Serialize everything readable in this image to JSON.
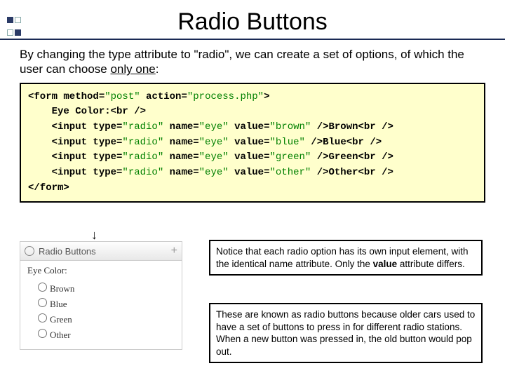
{
  "title": "Radio Buttons",
  "intro": {
    "part1": "By changing the type attribute to \"radio\", we can create a set of options, of which the user can choose ",
    "underline": "only one",
    "part2": ":"
  },
  "code": {
    "l1a": "<form method=",
    "l1b": "\"post\"",
    "l1c": " action=",
    "l1d": "\"process.php\"",
    "l1e": ">",
    "l2": "    Eye Color:<br />",
    "l3a": "    <input type=",
    "l3b": "\"radio\"",
    "l3c": " name=",
    "l3d": "\"eye\"",
    "l3e": " value=",
    "l3f": "\"brown\"",
    "l3g": " />Brown<br />",
    "l4f": "\"blue\"",
    "l4g": " />Blue<br />",
    "l5f": "\"green\"",
    "l5g": " />Green<br />",
    "l6f": "\"other\"",
    "l6g": " />Other<br />",
    "l7": "</form>"
  },
  "demo": {
    "header": "Radio Buttons",
    "label": "Eye Color:",
    "options": [
      "Brown",
      "Blue",
      "Green",
      "Other"
    ]
  },
  "note1": {
    "p1": "Notice that each radio option has its own input element, with the identical name attribute.  Only the ",
    "b": "value",
    "p2": " attribute differs."
  },
  "note2": "These are known as radio buttons because older cars used to have a set of buttons to press in for different radio stations.  When a new button was pressed in, the old button would pop out."
}
